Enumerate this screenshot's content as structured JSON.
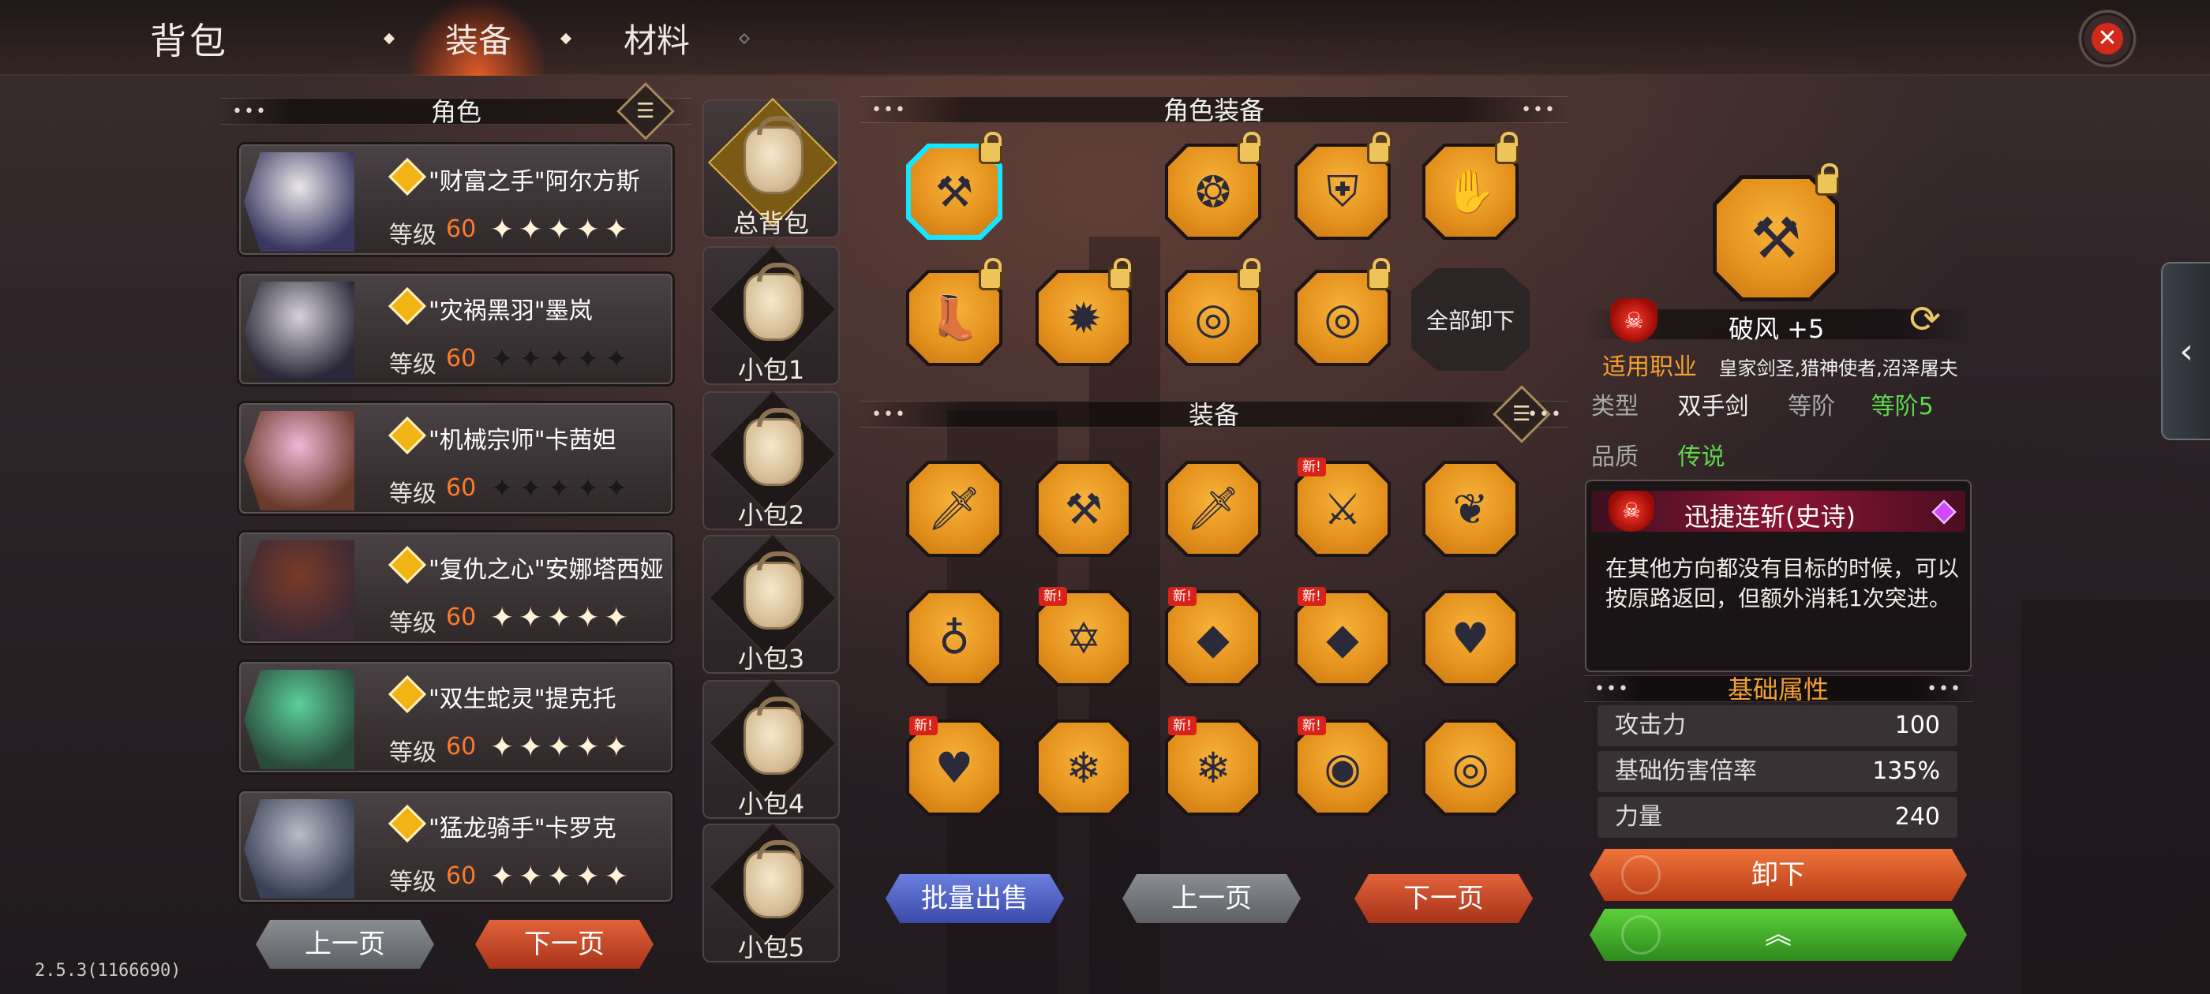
{
  "header": {
    "title": "背包",
    "tabs": [
      {
        "label": "装备",
        "active": true
      },
      {
        "label": "材料",
        "active": false
      }
    ]
  },
  "characters": {
    "header": "角色",
    "items": [
      {
        "name": "\"财富之手\"阿尔方斯",
        "level_label": "等级",
        "level": "60",
        "stars_lit": 5
      },
      {
        "name": "\"灾祸黑羽\"墨岚",
        "level_label": "等级",
        "level": "60",
        "stars_lit": 0
      },
      {
        "name": "\"机械宗师\"卡茜妲",
        "level_label": "等级",
        "level": "60",
        "stars_lit": 0
      },
      {
        "name": "\"复仇之心\"安娜塔西娅",
        "level_label": "等级",
        "level": "60",
        "stars_lit": 5
      },
      {
        "name": "\"双生蛇灵\"提克托",
        "level_label": "等级",
        "level": "60",
        "stars_lit": 5
      },
      {
        "name": "\"猛龙骑手\"卡罗克",
        "level_label": "等级",
        "level": "60",
        "stars_lit": 5
      }
    ],
    "prev": "上一页",
    "next": "下一页"
  },
  "bags": [
    "总背包",
    "小包1",
    "小包2",
    "小包3",
    "小包4",
    "小包5"
  ],
  "role_equipment": {
    "header": "角色装备",
    "unequip_all": "全部卸下",
    "slots": [
      {
        "icon": "axe-icon",
        "glyph": "⚒",
        "locked": true,
        "selected": true
      },
      {
        "icon": "bracer-icon",
        "glyph": "❂",
        "locked": true
      },
      {
        "icon": "armor-icon",
        "glyph": "⛨",
        "locked": true
      },
      {
        "icon": "gloves-icon",
        "glyph": "✋",
        "locked": true
      },
      {
        "icon": "boots-icon",
        "glyph": "👢",
        "locked": true
      },
      {
        "icon": "amulet-icon",
        "glyph": "✹",
        "locked": true
      },
      {
        "icon": "ring-icon",
        "glyph": "◎",
        "locked": true
      },
      {
        "icon": "ring-icon",
        "glyph": "◎",
        "locked": true
      }
    ]
  },
  "inventory": {
    "header": "装备",
    "new_label": "新!",
    "items": [
      {
        "icon": "dagger-icon",
        "glyph": "🗡",
        "new": false
      },
      {
        "icon": "axe-icon",
        "glyph": "⚒",
        "new": false
      },
      {
        "icon": "dagger-icon",
        "glyph": "🗡",
        "new": false
      },
      {
        "icon": "sword-icon",
        "glyph": "⚔",
        "new": true
      },
      {
        "icon": "wings-icon",
        "glyph": "❦",
        "new": false
      },
      {
        "icon": "necklace-icon",
        "glyph": "♁",
        "new": false
      },
      {
        "icon": "star-amulet-icon",
        "glyph": "✡",
        "new": true
      },
      {
        "icon": "sapphire-necklace-icon",
        "glyph": "◆",
        "new": true
      },
      {
        "icon": "sapphire-necklace-icon",
        "glyph": "◆",
        "new": true
      },
      {
        "icon": "heart-necklace-icon",
        "glyph": "♥",
        "new": false
      },
      {
        "icon": "heart-necklace-icon",
        "glyph": "♥",
        "new": true
      },
      {
        "icon": "crystal-charm-icon",
        "glyph": "❄",
        "new": false
      },
      {
        "icon": "crystal-charm-icon",
        "glyph": "❄",
        "new": true
      },
      {
        "icon": "amethyst-ring-icon",
        "glyph": "◉",
        "new": true
      },
      {
        "icon": "gold-ring-icon",
        "glyph": "◎",
        "new": false
      }
    ],
    "bulk_sell": "批量出售",
    "prev": "上一页",
    "next": "下一页"
  },
  "detail": {
    "item_name": "破风 +5",
    "class_label": "适用职业",
    "classes": "皇家剑圣,猎神使者,沼泽屠夫",
    "type_label": "类型",
    "type": "双手剑",
    "tier_label": "等阶",
    "tier": "等阶5",
    "quality_label": "品质",
    "quality": "传说",
    "skill_name": "迅捷连斩(史诗)",
    "skill_desc": "在其他方向都没有目标的时候，可以按原路返回，但额外消耗1次突进。",
    "base_attr_header": "基础属性",
    "stats": [
      {
        "k": "攻击力",
        "v": "100"
      },
      {
        "k": "基础伤害倍率",
        "v": "135%"
      },
      {
        "k": "力量",
        "v": "240"
      }
    ],
    "unequip": "卸下",
    "upgrade": "︽"
  },
  "version": "2.5.3(1166690)",
  "colors": {
    "accent_orange": "#ff7a28",
    "quality_green": "#5fd84a",
    "class_orange": "#f2a030"
  }
}
